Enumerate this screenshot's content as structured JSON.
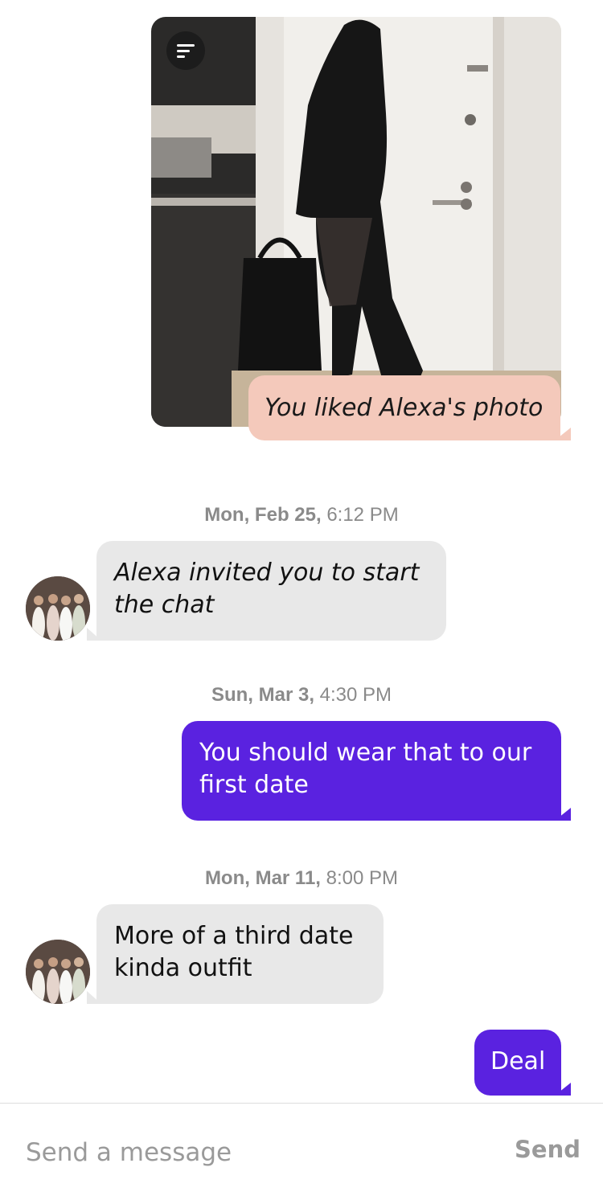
{
  "conversation": {
    "photo_message": {
      "caption": "You liked Alexa's photo",
      "photo_menu_icon": "menu-lines-icon"
    },
    "messages": [
      {
        "timestamp_day": "Mon, Feb 25,",
        "timestamp_time": "6:12 PM",
        "direction": "incoming",
        "text_lines": [
          "Alexa invited you to start",
          "the chat"
        ]
      },
      {
        "timestamp_day": "Sun, Mar 3,",
        "timestamp_time": "4:30 PM",
        "direction": "outgoing",
        "text_lines": [
          "You should wear that to our",
          "first date"
        ]
      },
      {
        "timestamp_day": "Mon, Mar 11,",
        "timestamp_time": "8:00 PM",
        "direction": "incoming",
        "text_lines": [
          "More of a third date",
          "kinda outfit"
        ]
      },
      {
        "direction": "outgoing",
        "text_lines": [
          "Deal"
        ]
      }
    ]
  },
  "composer": {
    "placeholder": "Send a message",
    "send_label": "Send"
  },
  "colors": {
    "outgoing_bubble": "#5a22e0",
    "incoming_bubble": "#e8e8e8",
    "liked_bubble": "#f4c9bb"
  }
}
